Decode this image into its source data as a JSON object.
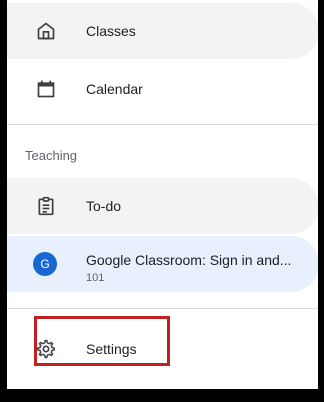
{
  "nav": {
    "classes_label": "Classes",
    "calendar_label": "Calendar",
    "section_teaching": "Teaching",
    "todo_label": "To-do",
    "class_item": {
      "avatar_letter": "G",
      "title": "Google Classroom: Sign in and...",
      "subtitle": "101"
    },
    "settings_label": "Settings"
  },
  "icons": {
    "classes": "home-icon",
    "calendar": "calendar-icon",
    "todo": "assignment-icon",
    "settings": "gear-icon"
  },
  "colors": {
    "avatar_bg": "#1967d2",
    "active_bg": "#e8f0fe",
    "hover_bg": "#f1f3f4",
    "highlight": "#c0201e",
    "divider": "#dadce0"
  }
}
